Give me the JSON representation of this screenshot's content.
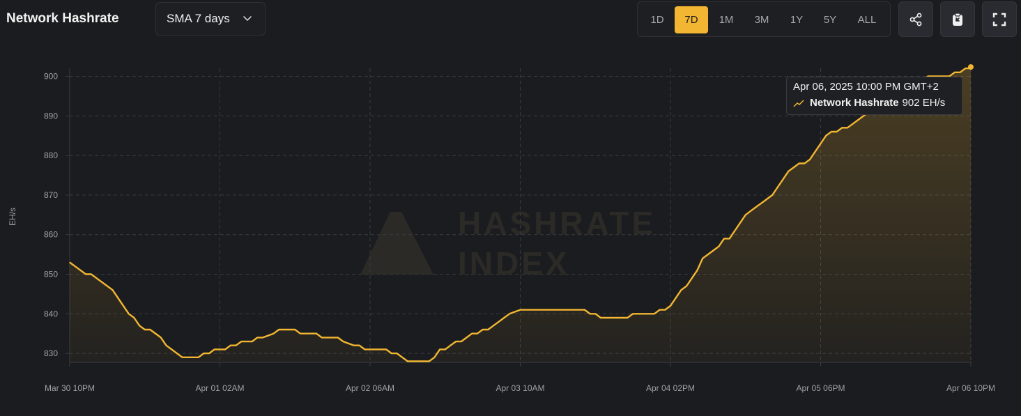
{
  "header": {
    "title": "Network Hashrate",
    "sma_select": {
      "label": "SMA 7 days"
    },
    "ranges": [
      "1D",
      "7D",
      "1M",
      "3M",
      "1Y",
      "5Y",
      "ALL"
    ],
    "active_range": "7D",
    "actions": [
      "share-icon",
      "clipboard-icon",
      "fullscreen-icon"
    ]
  },
  "watermark": {
    "line1": "HASHRATE",
    "line2": "INDEX"
  },
  "tooltip": {
    "date": "Apr 06, 2025 10:00 PM GMT+2",
    "series": "Network Hashrate",
    "value": "902 EH/s"
  },
  "colors": {
    "accent": "#f2b632",
    "background": "#1b1c1f",
    "grid": "#3a3b40"
  },
  "chart_data": {
    "type": "area",
    "ylabel": "EH/s",
    "ylim": [
      827,
      903
    ],
    "yticks": [
      830,
      840,
      850,
      860,
      870,
      880,
      890,
      900
    ],
    "xticks": [
      "Mar 30 10PM",
      "Apr 01 02AM",
      "Apr 02 06AM",
      "Apr 03 10AM",
      "Apr 04 02PM",
      "Apr 05 06PM",
      "Apr 06 10PM"
    ],
    "x_range_hours": [
      0,
      168
    ],
    "grid": true,
    "series": [
      {
        "name": "Network Hashrate",
        "x_hours": [
          0,
          2,
          3,
          4,
          5,
          7,
          8,
          9,
          10,
          11,
          12,
          13,
          14,
          15,
          17,
          18,
          19,
          20,
          21,
          22,
          23,
          24,
          25,
          26,
          27,
          28,
          29,
          30,
          31,
          32,
          33,
          34,
          35,
          36,
          38,
          39,
          41,
          42,
          43,
          45,
          46,
          47,
          48,
          49,
          50,
          51,
          53,
          54,
          55,
          56,
          58,
          59,
          60,
          61,
          62,
          63,
          64,
          65,
          66,
          67,
          68,
          69,
          70,
          71,
          72,
          73,
          74,
          75,
          76,
          77,
          78,
          79,
          80,
          81,
          82,
          84,
          87,
          88,
          89,
          90,
          92,
          93,
          94,
          95,
          96,
          97,
          98,
          99,
          100,
          101,
          102,
          103,
          104,
          105,
          106,
          107,
          108,
          109,
          110,
          111,
          112,
          113,
          114,
          115,
          116,
          117,
          118,
          119,
          120,
          121,
          122,
          123,
          124,
          125,
          126,
          127,
          128,
          129,
          130,
          131,
          132,
          133,
          134,
          135,
          136,
          137,
          138,
          139,
          140,
          141,
          142,
          143,
          144,
          145,
          146,
          147,
          148,
          149,
          150,
          151,
          152,
          153,
          154,
          155,
          156,
          157,
          158,
          159,
          160,
          161,
          162,
          163,
          164,
          165,
          166,
          167,
          168
        ],
        "values": [
          853,
          851,
          850,
          850,
          849,
          847,
          846,
          844,
          842,
          840,
          839,
          837,
          836,
          836,
          834,
          832,
          831,
          830,
          829,
          829,
          829,
          829,
          830,
          830,
          831,
          831,
          831,
          832,
          832,
          833,
          833,
          833,
          834,
          834,
          835,
          836,
          836,
          836,
          835,
          835,
          835,
          834,
          834,
          834,
          834,
          833,
          832,
          832,
          831,
          831,
          831,
          831,
          830,
          830,
          829,
          828,
          828,
          828,
          828,
          828,
          829,
          831,
          831,
          832,
          833,
          833,
          834,
          835,
          835,
          836,
          836,
          837,
          838,
          839,
          840,
          841,
          841,
          841,
          841,
          841,
          841,
          841,
          841,
          841,
          841,
          840,
          840,
          839,
          839,
          839,
          839,
          839,
          839,
          840,
          840,
          840,
          840,
          840,
          841,
          841,
          842,
          844,
          846,
          847,
          849,
          851,
          854,
          855,
          856,
          857,
          859,
          859,
          861,
          863,
          865,
          866,
          867,
          868,
          869,
          870,
          872,
          874,
          876,
          877,
          878,
          878,
          879,
          881,
          883,
          885,
          886,
          886,
          887,
          887,
          888,
          889,
          890,
          891,
          892,
          893,
          894,
          895,
          896,
          897,
          898,
          898,
          899,
          899,
          900,
          900,
          900,
          900,
          900,
          901,
          901,
          902,
          902
        ]
      }
    ]
  }
}
